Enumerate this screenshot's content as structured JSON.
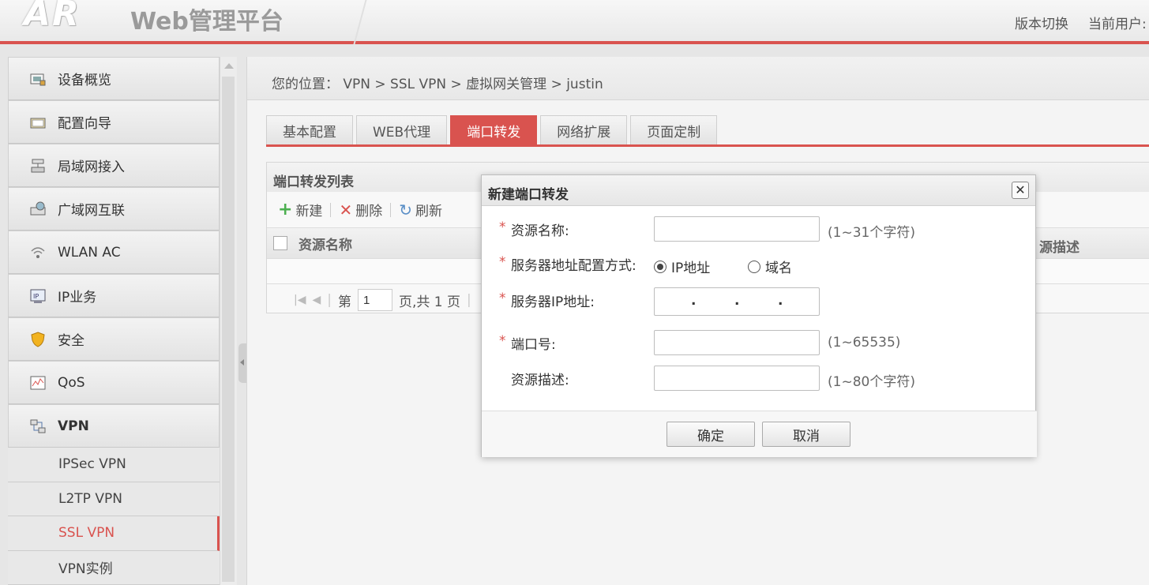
{
  "header": {
    "logo": "AR",
    "title": "Web管理平台",
    "version_switch": "版本切换",
    "current_user": "当前用户:"
  },
  "sidebar": {
    "items": [
      {
        "label": "设备概览",
        "icon": "device-overview-icon"
      },
      {
        "label": "配置向导",
        "icon": "config-wizard-icon"
      },
      {
        "label": "局域网接入",
        "icon": "lan-icon"
      },
      {
        "label": "广域网互联",
        "icon": "wan-icon"
      },
      {
        "label": "WLAN AC",
        "icon": "wlan-icon"
      },
      {
        "label": "IP业务",
        "icon": "ip-service-icon"
      },
      {
        "label": "安全",
        "icon": "shield-icon"
      },
      {
        "label": "QoS",
        "icon": "qos-icon"
      },
      {
        "label": "VPN",
        "icon": "vpn-icon"
      }
    ],
    "vpn_sub": [
      "IPSec VPN",
      "L2TP VPN",
      "SSL VPN",
      "VPN实例"
    ],
    "active_sub": "SSL VPN"
  },
  "breadcrumb": "您的位置： VPN > SSL VPN > 虚拟网关管理 > justin",
  "tabs": [
    "基本配置",
    "WEB代理",
    "端口转发",
    "网络扩展",
    "页面定制"
  ],
  "active_tab": "端口转发",
  "panel": {
    "title": "端口转发列表",
    "toolbar": {
      "new": "新建",
      "delete": "删除",
      "refresh": "刷新"
    },
    "columns": {
      "name": "资源名称",
      "desc": "源描述"
    },
    "pager": {
      "prefix": "第",
      "page": "1",
      "suffix": "页,共 1 页"
    }
  },
  "dialog": {
    "title": "新建端口转发",
    "close": "✕",
    "fields": {
      "name_label": "资源名称:",
      "name_hint": "(1~31个字符)",
      "mode_label": "服务器地址配置方式:",
      "mode_ip": "IP地址",
      "mode_domain": "域名",
      "mode_selected": "IP地址",
      "ip_label": "服务器IP地址:",
      "port_label": "端口号:",
      "port_hint": "(1~65535)",
      "desc_label": "资源描述:",
      "desc_hint": "(1~80个字符)"
    },
    "ok": "确定",
    "cancel": "取消"
  },
  "colors": {
    "accent": "#d9534f"
  }
}
